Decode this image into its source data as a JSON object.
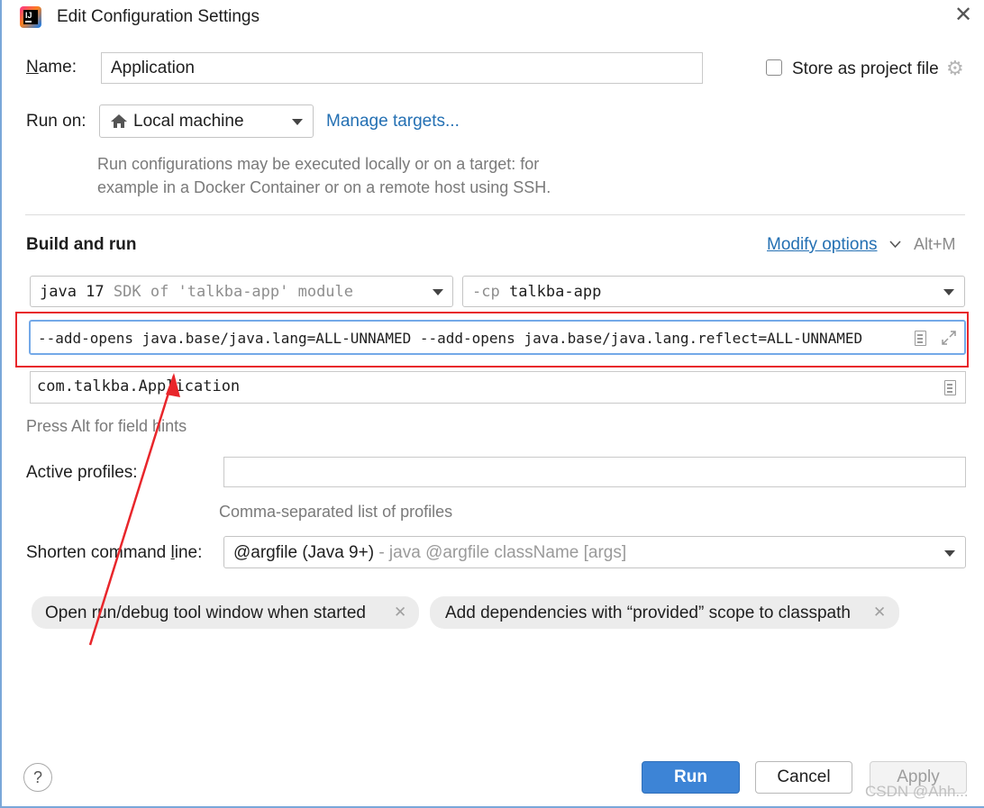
{
  "window": {
    "title": "Edit Configuration Settings",
    "close_glyph": "✕"
  },
  "name": {
    "label": "Name:",
    "value": "Application"
  },
  "store": {
    "label": "Store as project file",
    "checked": false
  },
  "run_on": {
    "label": "Run on:",
    "selected": "Local machine",
    "manage_link": "Manage targets...",
    "hint_line1": "Run configurations may be executed locally or on a target: for",
    "hint_line2": "example in a Docker Container or on a remote host using SSH."
  },
  "build": {
    "heading": "Build and run",
    "modify_options": "Modify options",
    "modify_shortcut": "Alt+M",
    "jdk_version": "java 17",
    "jdk_desc": "SDK of 'talkba-app' module",
    "cp_flag": "-cp",
    "cp_value": "talkba-app",
    "vm_options": "--add-opens java.base/java.lang=ALL-UNNAMED --add-opens java.base/java.lang.reflect=ALL-UNNAMED",
    "main_class": "com.talkba.Application",
    "field_hint": "Press Alt for field hints"
  },
  "profiles": {
    "label": "Active profiles:",
    "value": "",
    "hint": "Comma-separated list of profiles"
  },
  "shorten": {
    "label": "Shorten command line:",
    "selected": "@argfile (Java 9+)",
    "desc": "- java @argfile className [args]"
  },
  "tags": [
    {
      "label": "Open run/debug tool window when started"
    },
    {
      "label": "Add dependencies with “provided” scope to classpath"
    }
  ],
  "buttons": {
    "run": "Run",
    "cancel": "Cancel",
    "apply": "Apply",
    "help": "?"
  },
  "watermark": "CSDN @Ahh...",
  "annotation_color": "#e8262b",
  "accent_color": "#3d84d6",
  "icons": [
    "app-logo-icon",
    "home-icon",
    "gear-icon",
    "chevron-down-icon",
    "document-icon",
    "expand-icon",
    "close-icon",
    "help-icon"
  ]
}
